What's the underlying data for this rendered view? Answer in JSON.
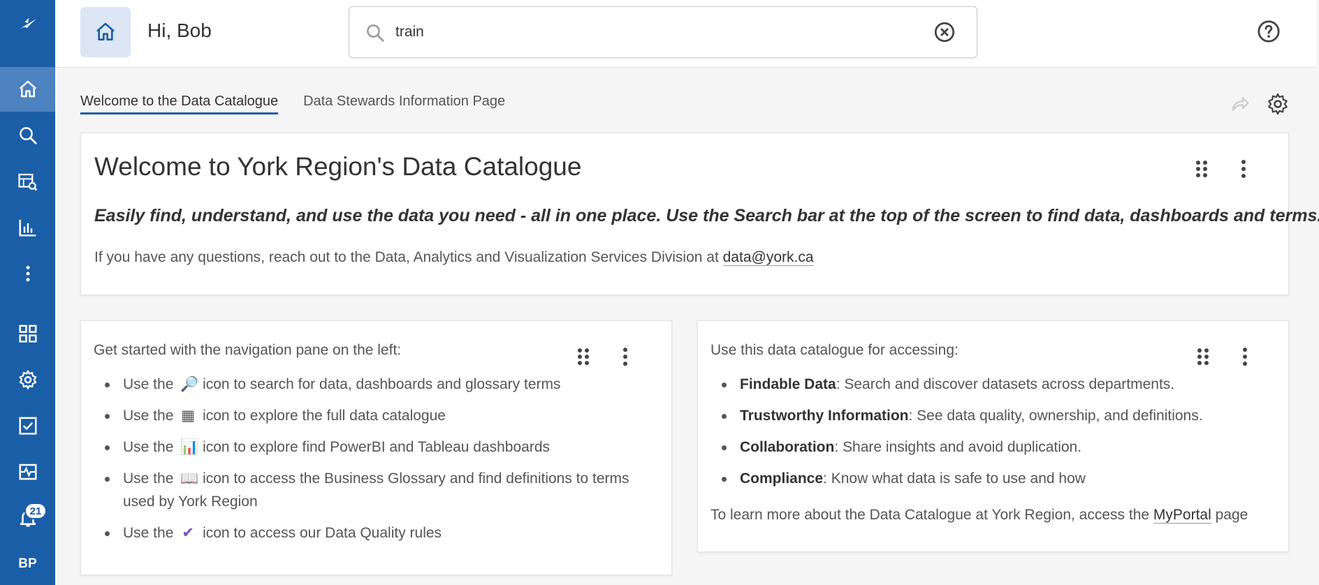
{
  "sidebar": {
    "notification_count": "21",
    "avatar_initials": "BP"
  },
  "header": {
    "greeting": "Hi, Bob",
    "search_value": "train"
  },
  "tabs": [
    {
      "label": "Welcome to the Data Catalogue",
      "active": true
    },
    {
      "label": "Data Stewards Information Page",
      "active": false
    }
  ],
  "welcome_card": {
    "title": "Welcome to York Region's Data Catalogue",
    "subtitle": "Easily find, understand, and use the data you need - all in one place. Use the Search bar at the top of the screen to find data, dashboards and terms.",
    "info_prefix": "If you have any questions, reach out to the Data, Analytics and Visualization Services Division at ",
    "info_email": "data@york.ca"
  },
  "nav_card": {
    "intro": "Get started with the navigation pane on the left:",
    "items": [
      {
        "prefix": "Use the",
        "icon": "🔎",
        "text": "icon to search for data, dashboards and glossary terms"
      },
      {
        "prefix": "Use the",
        "icon": "▦",
        "text": "icon to explore the full data catalogue"
      },
      {
        "prefix": "Use the",
        "icon": "📊",
        "text": "icon to explore find PowerBI and Tableau dashboards"
      },
      {
        "prefix": "Use the",
        "icon": "📖",
        "text": "icon to access the Business Glossary and find definitions to terms used by York Region"
      },
      {
        "prefix": "Use the",
        "icon": "✔",
        "text": "icon to access our Data Quality rules"
      }
    ]
  },
  "usage_card": {
    "intro": "Use this data catalogue for accessing:",
    "items": [
      {
        "bold": "Findable Data",
        "text": ": Search and discover datasets across departments."
      },
      {
        "bold": "Trustworthy Information",
        "text": ": See data quality, ownership, and definitions."
      },
      {
        "bold": "Collaboration",
        "text": ": Share insights and avoid duplication."
      },
      {
        "bold": "Compliance",
        "text": ": Know what data is safe to use and how"
      }
    ],
    "footer_prefix": "To learn more about the Data Catalogue at York Region, access the ",
    "footer_link": "MyPortal",
    "footer_suffix": " page"
  },
  "colors": {
    "sidebar": "#1a5ea8",
    "sidebar_active": "#4b82bf",
    "home_button_bg": "#dce6f5",
    "tab_underline": "#1a5ea8"
  }
}
